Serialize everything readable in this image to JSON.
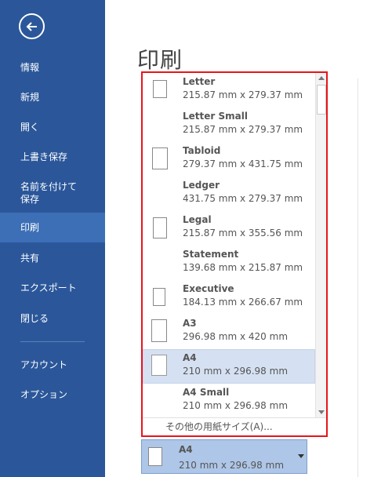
{
  "sidebar": {
    "back_icon": "arrow-left-icon",
    "items": [
      {
        "label": "情報",
        "active": false
      },
      {
        "label": "新規",
        "active": false
      },
      {
        "label": "開く",
        "active": false
      },
      {
        "label": "上書き保存",
        "active": false
      },
      {
        "label": "名前を付けて\n保存",
        "active": false
      },
      {
        "label": "印刷",
        "active": true
      },
      {
        "label": "共有",
        "active": false
      },
      {
        "label": "エクスポート",
        "active": false
      },
      {
        "label": "閉じる",
        "active": false
      },
      {
        "label": "アカウント",
        "active": false
      },
      {
        "label": "オプション",
        "active": false
      }
    ]
  },
  "main": {
    "title": "印刷"
  },
  "paper_dropdown": {
    "items": [
      {
        "name": "Letter",
        "dimensions": "215.87 mm x 279.37 mm",
        "icon": "paper-portrait-icon"
      },
      {
        "name": "Letter Small",
        "dimensions": "215.87 mm x 279.37 mm",
        "icon": ""
      },
      {
        "name": "Tabloid",
        "dimensions": "279.37 mm x 431.75 mm",
        "icon": "paper-portrait-icon"
      },
      {
        "name": "Ledger",
        "dimensions": "431.75 mm x 279.37 mm",
        "icon": ""
      },
      {
        "name": "Legal",
        "dimensions": "215.87 mm x 355.56 mm",
        "icon": "paper-portrait-icon"
      },
      {
        "name": "Statement",
        "dimensions": "139.68 mm x 215.87 mm",
        "icon": ""
      },
      {
        "name": "Executive",
        "dimensions": "184.13 mm x 266.67 mm",
        "icon": "paper-portrait-icon"
      },
      {
        "name": "A3",
        "dimensions": "296.98 mm x 420 mm",
        "icon": "paper-portrait-icon"
      },
      {
        "name": "A4",
        "dimensions": "210 mm x 296.98 mm",
        "icon": "paper-portrait-icon",
        "selected": true
      },
      {
        "name": "A4 Small",
        "dimensions": "210 mm x 296.98 mm",
        "icon": ""
      }
    ],
    "more_sizes": "その他の用紙サイズ(A)..."
  },
  "paper_select": {
    "name": "A4",
    "dimensions": "210 mm x 296.98 mm"
  },
  "colors": {
    "sidebar_bg": "#2b579a",
    "sidebar_active": "#3c6fb6",
    "highlight_border": "#e8141c",
    "selected_item": "#d5e1f2",
    "select_bg": "#aec6e7"
  }
}
